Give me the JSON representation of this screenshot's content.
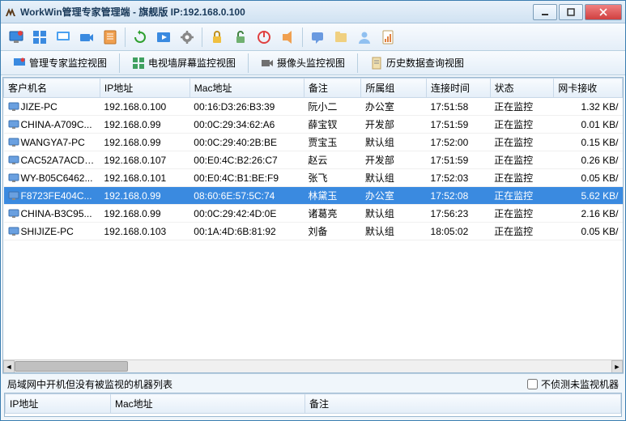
{
  "window": {
    "title": "WorkWin管理专家管理端 - 旗舰版 IP:192.168.0.100"
  },
  "tabs": [
    {
      "label": "管理专家监控视图"
    },
    {
      "label": "电视墙屏幕监控视图"
    },
    {
      "label": "摄像头监控视图"
    },
    {
      "label": "历史数据查询视图"
    }
  ],
  "columns": {
    "client": "客户机名",
    "ip": "IP地址",
    "mac": "Mac地址",
    "remark": "备注",
    "group": "所属组",
    "conntime": "连接时间",
    "status": "状态",
    "netrecv": "网卡接收"
  },
  "rows": [
    {
      "client": "JIZE-PC",
      "ip": "192.168.0.100",
      "mac": "00:16:D3:26:B3:39",
      "remark": "阮小二",
      "group": "办公室",
      "conntime": "17:51:58",
      "status": "正在监控",
      "netrecv": "1.32 KB/",
      "selected": false
    },
    {
      "client": "CHINA-A709C...",
      "ip": "192.168.0.99",
      "mac": "00:0C:29:34:62:A6",
      "remark": "薛宝钗",
      "group": "开发部",
      "conntime": "17:51:59",
      "status": "正在监控",
      "netrecv": "0.01 KB/",
      "selected": false
    },
    {
      "client": "WANGYA7-PC",
      "ip": "192.168.0.99",
      "mac": "00:0C:29:40:2B:BE",
      "remark": "贾宝玉",
      "group": "默认组",
      "conntime": "17:52:00",
      "status": "正在监控",
      "netrecv": "0.15 KB/",
      "selected": false
    },
    {
      "client": "CAC52A7ACD7...",
      "ip": "192.168.0.107",
      "mac": "00:E0:4C:B2:26:C7",
      "remark": "赵云",
      "group": "开发部",
      "conntime": "17:51:59",
      "status": "正在监控",
      "netrecv": "0.26 KB/",
      "selected": false
    },
    {
      "client": "WY-B05C6462...",
      "ip": "192.168.0.101",
      "mac": "00:E0:4C:B1:BE:F9",
      "remark": "张飞",
      "group": "默认组",
      "conntime": "17:52:03",
      "status": "正在监控",
      "netrecv": "0.05 KB/",
      "selected": false
    },
    {
      "client": "F8723FE404C...",
      "ip": "192.168.0.99",
      "mac": "08:60:6E:57:5C:74",
      "remark": "林黛玉",
      "group": "办公室",
      "conntime": "17:52:08",
      "status": "正在监控",
      "netrecv": "5.62 KB/",
      "selected": true
    },
    {
      "client": "CHINA-B3C95...",
      "ip": "192.168.0.99",
      "mac": "00:0C:29:42:4D:0E",
      "remark": "诸葛亮",
      "group": "默认组",
      "conntime": "17:56:23",
      "status": "正在监控",
      "netrecv": "2.16 KB/",
      "selected": false
    },
    {
      "client": "SHIJIZE-PC",
      "ip": "192.168.0.103",
      "mac": "00:1A:4D:6B:81:92",
      "remark": "刘备",
      "group": "默认组",
      "conntime": "18:05:02",
      "status": "正在监控",
      "netrecv": "0.05 KB/",
      "selected": false
    }
  ],
  "bottom": {
    "label": "局域网中开机但没有被监视的机器列表",
    "checkbox": "不侦测未监视机器",
    "columns": {
      "ip": "IP地址",
      "mac": "Mac地址",
      "remark": "备注"
    }
  }
}
